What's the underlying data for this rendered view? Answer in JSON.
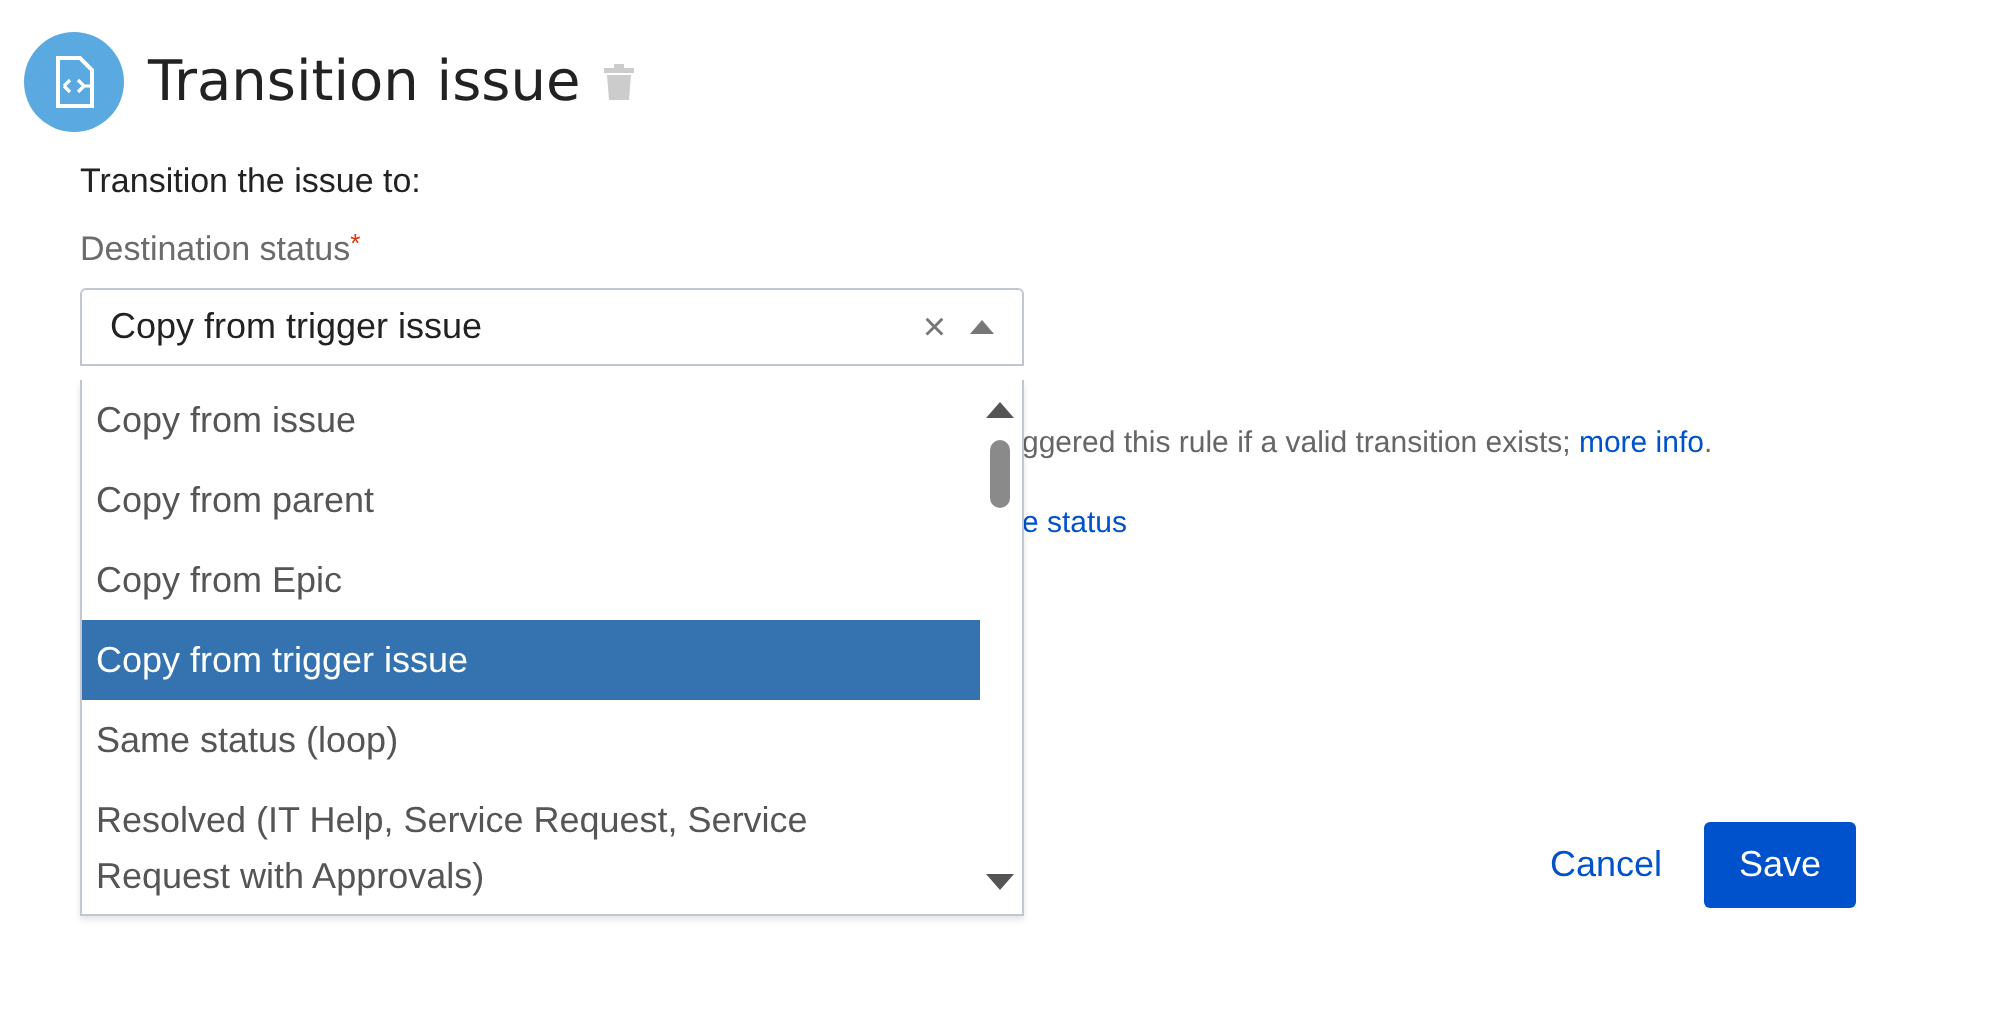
{
  "header": {
    "title": "Transition issue"
  },
  "intro": "Transition the issue to:",
  "field": {
    "label": "Destination status",
    "required_mark": "*",
    "value": "Copy from trigger issue",
    "clear": "×",
    "expanded": true
  },
  "options": [
    {
      "label": "Copy from issue",
      "selected": false
    },
    {
      "label": "Copy from parent",
      "selected": false
    },
    {
      "label": "Copy from Epic",
      "selected": false
    },
    {
      "label": "Copy from trigger issue",
      "selected": true
    },
    {
      "label": "Same status (loop)",
      "selected": false
    },
    {
      "label": "Resolved (IT Help, Service Request, Service Request with Approvals)",
      "selected": false
    }
  ],
  "help": {
    "text": "ggered this rule if a valid transition exists; ",
    "link": "more info",
    "end": "."
  },
  "link_2": "e status",
  "buttons": {
    "cancel": "Cancel",
    "save": "Save"
  }
}
